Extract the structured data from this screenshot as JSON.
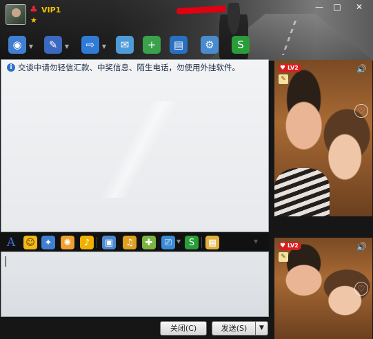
{
  "titlebar": {
    "vip_label": "VIP1",
    "window_controls": {
      "minimize": "—",
      "maximize": "□",
      "close": "✕"
    }
  },
  "toolbar": {
    "items": [
      {
        "icon": "video-call-icon",
        "glyph": "◉",
        "color": "#3f7fd1",
        "has_dropdown": true
      },
      {
        "icon": "voice-call-icon",
        "glyph": "✎",
        "color": "#3c68c0",
        "has_dropdown": true
      },
      {
        "icon": "file-transfer-icon",
        "glyph": "⇨",
        "color": "#2f7bd6",
        "has_dropdown": true
      },
      {
        "icon": "email-icon",
        "glyph": "✉",
        "color": "#4f9bd9",
        "has_dropdown": false
      },
      {
        "icon": "add-contact-icon",
        "glyph": "+",
        "color": "#3aa24a",
        "has_dropdown": false
      },
      {
        "icon": "contact-card-icon",
        "glyph": "▤",
        "color": "#2a70c2",
        "has_dropdown": false
      },
      {
        "icon": "settings-icon",
        "glyph": "⚙",
        "color": "#4a8bd0",
        "has_dropdown": false
      },
      {
        "icon": "service-icon",
        "glyph": "S",
        "color": "#2a9d3a",
        "has_dropdown": false
      }
    ]
  },
  "history": {
    "notice_text": "交谈中请勿轻信汇款、中奖信息、陌生电话，勿使用外挂软件。"
  },
  "input_toolbar": {
    "items": [
      {
        "icon": "font-icon",
        "glyph": "A",
        "color": "transparent",
        "text_color": "#3a74d8"
      },
      {
        "icon": "emoji-icon",
        "glyph": "☺",
        "color": "#f1b91a",
        "text_color": "#5a3a00"
      },
      {
        "icon": "magic-face-icon",
        "glyph": "✦",
        "color": "#3f7fd1",
        "text_color": "#fff"
      },
      {
        "icon": "shake-icon",
        "glyph": "✺",
        "color": "#f0a030",
        "text_color": "#fff"
      },
      {
        "icon": "voice-message-icon",
        "glyph": "♪",
        "color": "#f0b000",
        "text_color": "#fff"
      },
      {
        "icon": "image-icon",
        "glyph": "▣",
        "color": "#4a8bd0",
        "text_color": "#fff"
      },
      {
        "icon": "music-icon",
        "glyph": "♫",
        "color": "#e0a020",
        "text_color": "#fff"
      },
      {
        "icon": "gift-icon",
        "glyph": "✚",
        "color": "#7cb342",
        "text_color": "#fff"
      },
      {
        "icon": "screenshot-icon",
        "glyph": "⎚",
        "color": "#3a8ad6",
        "text_color": "#fff"
      },
      {
        "icon": "service-icon",
        "glyph": "S",
        "color": "#2a9d3a",
        "text_color": "#fff"
      },
      {
        "icon": "chat-history-icon",
        "glyph": "▦",
        "color": "#e0b040",
        "text_color": "#fff"
      }
    ]
  },
  "buttons": {
    "close_label": "关闭(C)",
    "send_label": "发送(S)",
    "send_dropdown": "▼"
  },
  "video_top": {
    "level_badge": "LV2",
    "speaker": "🔊",
    "heart": "♡"
  },
  "video_bottom": {
    "level_badge": "LV2",
    "speaker": "🔊",
    "heart": "♡"
  }
}
